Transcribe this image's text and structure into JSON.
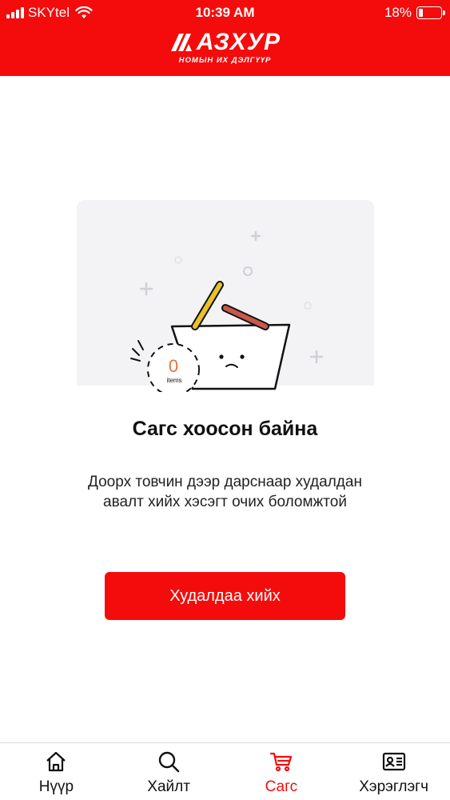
{
  "status_bar": {
    "carrier": "SKYtel",
    "time": "10:39 AM",
    "battery": "18%",
    "battery_level": 0.18,
    "signal_bars": 4
  },
  "header": {
    "logo_text": "АЗХУР",
    "logo_subtitle": "НОМЫН ИХ ДЭЛГҮҮР",
    "background": "#f40c0c"
  },
  "empty_cart": {
    "items_count": "0",
    "items_label": "items",
    "title": "Сагс хоосон байна",
    "description": "Доорх товчин дээр дарснаар худалдан авалт хийх хэсэгт очих боломжтой",
    "button_label": "Худалдаа хийх"
  },
  "nav": {
    "items": [
      {
        "label": "Нүүр",
        "icon": "home-icon"
      },
      {
        "label": "Хайлт",
        "icon": "search-icon"
      },
      {
        "label": "Сагс",
        "icon": "cart-icon",
        "active": true
      },
      {
        "label": "Хэрэглэгч",
        "icon": "user-card-icon"
      }
    ],
    "active_color": "#f40c0c"
  }
}
